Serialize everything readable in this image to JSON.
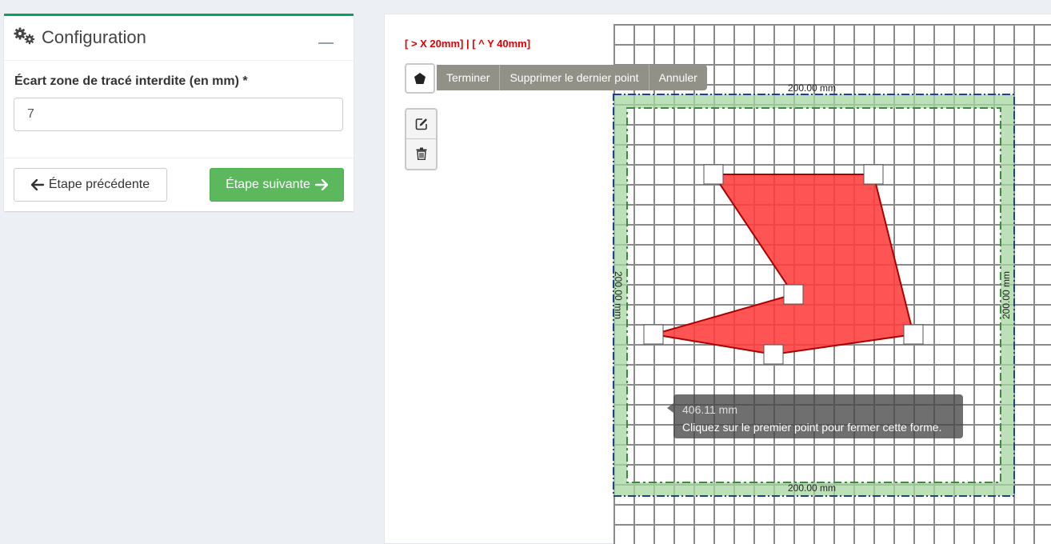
{
  "config": {
    "title": "Configuration",
    "field_label": "Écart zone de tracé interdite (en mm) *",
    "field_value": "7",
    "prev_label": "Étape précédente",
    "next_label": "Étape suivante",
    "colors": {
      "accent": "#00a65a",
      "next_button": "#5cb85c"
    }
  },
  "map": {
    "coords": "[ > X 20mm] | [ ^ Y 40mm]",
    "draw_actions": [
      "Terminer",
      "Supprimer le dernier point",
      "Annuler"
    ],
    "tooltip": {
      "measure": "406.11 mm",
      "message": "Cliquez sur le premier point pour fermer cette forme."
    },
    "dimensions": {
      "top": "200.00 mm",
      "bottom": "200.00 mm",
      "left": "200.00 mm",
      "right": "200.00 mm"
    },
    "colors": {
      "shape_fill": "#ff3c3c",
      "shape_stroke": "#aa0000",
      "zone_fill": "#a6d6a0",
      "zone_border": "#1f3f99",
      "dashed": "#3d8a3d"
    }
  }
}
